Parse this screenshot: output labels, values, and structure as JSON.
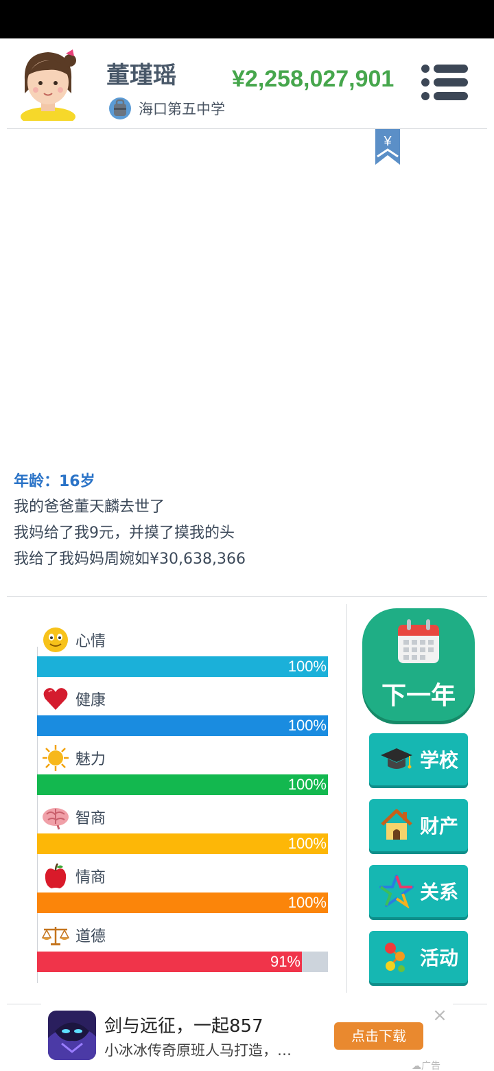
{
  "colors": {
    "money": "#46a64c",
    "age": "#2a73c7",
    "mood_bar": "#1bb0d9",
    "health_bar": "#1a8ce0",
    "charm_bar": "#13b84f",
    "iq_bar": "#fdb707",
    "eq_bar": "#fb850a",
    "morality_bar": "#f0344a",
    "next_year_button": "#1fae85",
    "action_button": "#16b7b2"
  },
  "header": {
    "name": "董瑾瑶",
    "school": "海口第五中学",
    "money": "¥2,258,027,901",
    "avatar_icon": "girl-avatar-icon",
    "school_icon": "school-bag-icon",
    "menu_icon": "list-menu-icon",
    "bookmark_symbol": "¥"
  },
  "log": {
    "age": "年龄：16岁",
    "lines": [
      "我的爸爸董天麟去世了",
      "我妈给了我9元，并摸了摸我的头",
      "我给了我妈妈周婉如¥30,638,366"
    ]
  },
  "stats": [
    {
      "label": "心情",
      "value": 100,
      "text": "100%",
      "icon": "smiley-icon"
    },
    {
      "label": "健康",
      "value": 100,
      "text": "100%",
      "icon": "heart-icon"
    },
    {
      "label": "魅力",
      "value": 100,
      "text": "100%",
      "icon": "sun-icon"
    },
    {
      "label": "智商",
      "value": 100,
      "text": "100%",
      "icon": "brain-icon"
    },
    {
      "label": "情商",
      "value": 100,
      "text": "100%",
      "icon": "apple-icon"
    },
    {
      "label": "道德",
      "value": 91,
      "text": "91%",
      "icon": "scales-icon"
    }
  ],
  "actions": {
    "next_year": "下一年",
    "school": "学校",
    "property": "财产",
    "relations": "关系",
    "activities": "活动"
  },
  "ad": {
    "title": "剑与远征，一起857",
    "desc": "小冰冰传奇原班人马打造，…",
    "button": "点击下载",
    "close": "×",
    "tag": "☁广告"
  }
}
